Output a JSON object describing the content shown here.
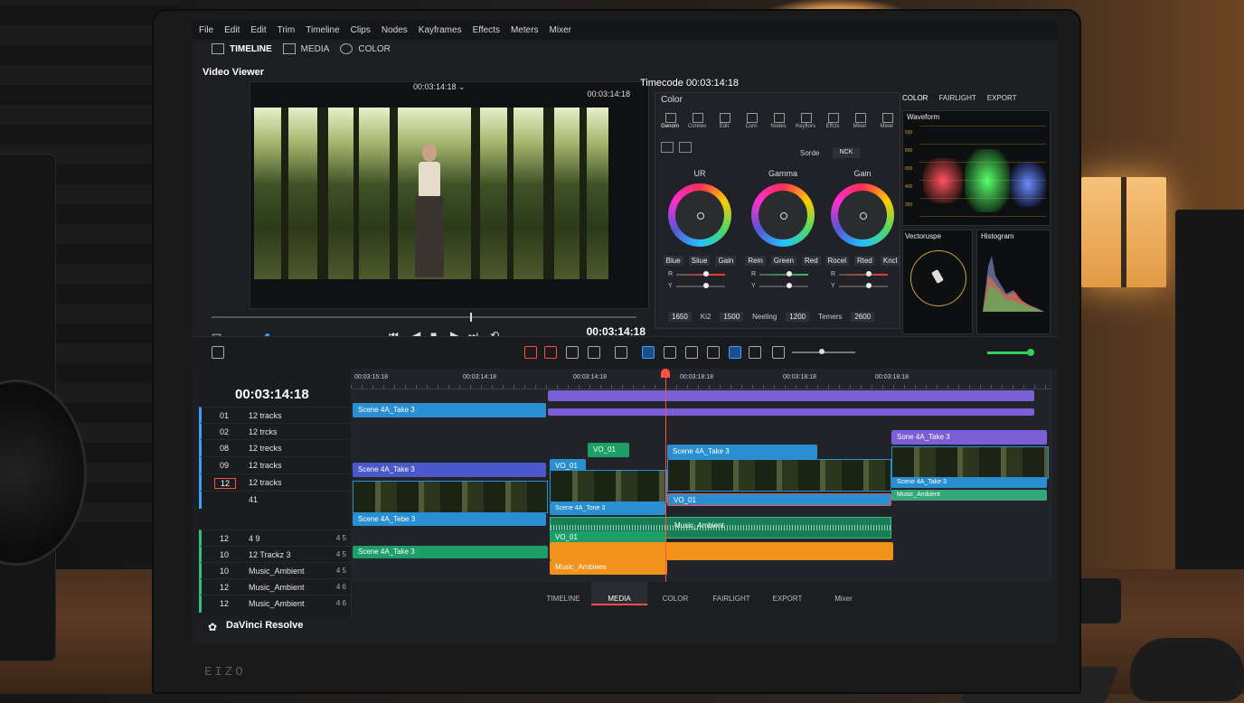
{
  "menu": [
    "File",
    "Edit",
    "Edit",
    "Trim",
    "Timeline",
    "Clips",
    "Nodes",
    "Kayframes",
    "Effects",
    "Meters",
    "Mixer"
  ],
  "page_tabs": [
    {
      "label": "TIMELINE",
      "active": true
    },
    {
      "label": "MEDIA",
      "active": false
    },
    {
      "label": "COLOR",
      "active": false
    }
  ],
  "viewer": {
    "label": "Video Viewer",
    "timecode": "00:03:14:18 ⌄",
    "timecode_right": "00:03:14:18",
    "transport_timecode": "00:03:14:18"
  },
  "timecode_header": "Timecode 00:03:14:18",
  "color_panel": {
    "title": "Color",
    "tools": [
      "Genom",
      "Corews",
      "Edit",
      "Curn",
      "Nodes",
      "Keyfiors",
      "Effcts",
      "Mixer",
      "Mixer"
    ],
    "mode_label": "Sorde",
    "mode_value": "NCK",
    "wheels": [
      {
        "title": "UR",
        "labels": [
          "Blue",
          "Siiue",
          "Gain"
        ],
        "sliders": [
          "R",
          "Y"
        ]
      },
      {
        "title": "Gamma",
        "labels": [
          "Rein",
          "Green",
          "Red"
        ],
        "sliders": [
          "R",
          "Y"
        ]
      },
      {
        "title": "Gain",
        "labels": [
          "Rocel",
          "Rted",
          "Kncl"
        ],
        "sliders": [
          "R",
          "Y"
        ]
      }
    ],
    "bottom": [
      {
        "label": "",
        "value": "1650"
      },
      {
        "label": "Ki2",
        "value": "1500"
      },
      {
        "label": "Neeling",
        "value": "1200"
      },
      {
        "label": "Temers",
        "value": "2600"
      }
    ]
  },
  "scopes": {
    "tabs": [
      "COLOR",
      "FAIRLIGHT",
      "EXPORT"
    ],
    "waveform_label": "Waveform",
    "waveform_ticks": [
      "500",
      "800",
      "600",
      "400",
      "300",
      "200",
      "100"
    ],
    "vectorscope_label": "Vectoruspe",
    "histogram_label": "Histogram"
  },
  "timeline": {
    "timecode": "00:03:14:18",
    "ruler": [
      "00:03:15:18",
      "00:03:14:18",
      "00:03:14:18",
      "00:03:18:18",
      "00:03:18:18",
      "00:03:18:18"
    ],
    "tracks": [
      {
        "num": "01",
        "name": "12 tracks",
        "color": "blue",
        "icon": ""
      },
      {
        "num": "02",
        "name": "12 trcks",
        "color": "blue",
        "icon": ""
      },
      {
        "num": "08",
        "name": "12 trecks",
        "color": "blue",
        "icon": ""
      },
      {
        "num": "09",
        "name": "12 tracks",
        "color": "blue",
        "icon": ""
      },
      {
        "num": "12",
        "name": "12 tracks",
        "color": "blue",
        "icon": "",
        "boxed": true
      },
      {
        "num": "",
        "name": "41",
        "color": "blue",
        "icon": ""
      },
      {
        "num": "12",
        "name": "4 9",
        "color": "green",
        "icon": "4 5"
      },
      {
        "num": "10",
        "name": "12 Trackz 3",
        "color": "green",
        "icon": "4 5"
      },
      {
        "num": "10",
        "name": "Music_Ambient",
        "color": "green",
        "icon": "4 5"
      },
      {
        "num": "12",
        "name": "Music_Ambient",
        "color": "green",
        "icon": "4 6"
      },
      {
        "num": "12",
        "name": "Music_Ambient",
        "color": "green",
        "icon": "4 6"
      }
    ],
    "clips": {
      "scene_top": "Scene 4A_Take 3",
      "vo_small": "VO_01",
      "scene_v2": "Scene 4A_Take 3",
      "vo_v2": "VO_01",
      "scene_mid": "Scene 4A_Take 3",
      "scene_far": "Sone 4A_Take 3",
      "film_label": "Scene 4A_Tone 3",
      "scene_far2": "Scene 4A_Take 3",
      "vo_a1": "VO_01",
      "a1_label": "Scene 4A_Tebe 3",
      "music": "Music_Ambient",
      "music_far": "Music_Ambient",
      "a2_label": "Scene 4A_Take 3",
      "a2_vo": "VO_01",
      "orange": "Music_Ambiees"
    }
  },
  "bottom_tabs": [
    {
      "label": "TIMELINE"
    },
    {
      "label": "MEDIA",
      "active": true
    },
    {
      "label": "COLOR"
    },
    {
      "label": "FAIRLIGHT"
    },
    {
      "label": "EXPORT"
    },
    {
      "label": "Mixer"
    }
  ],
  "app_name": "DaVinci Resolve",
  "bezel_brand": "EIZO"
}
